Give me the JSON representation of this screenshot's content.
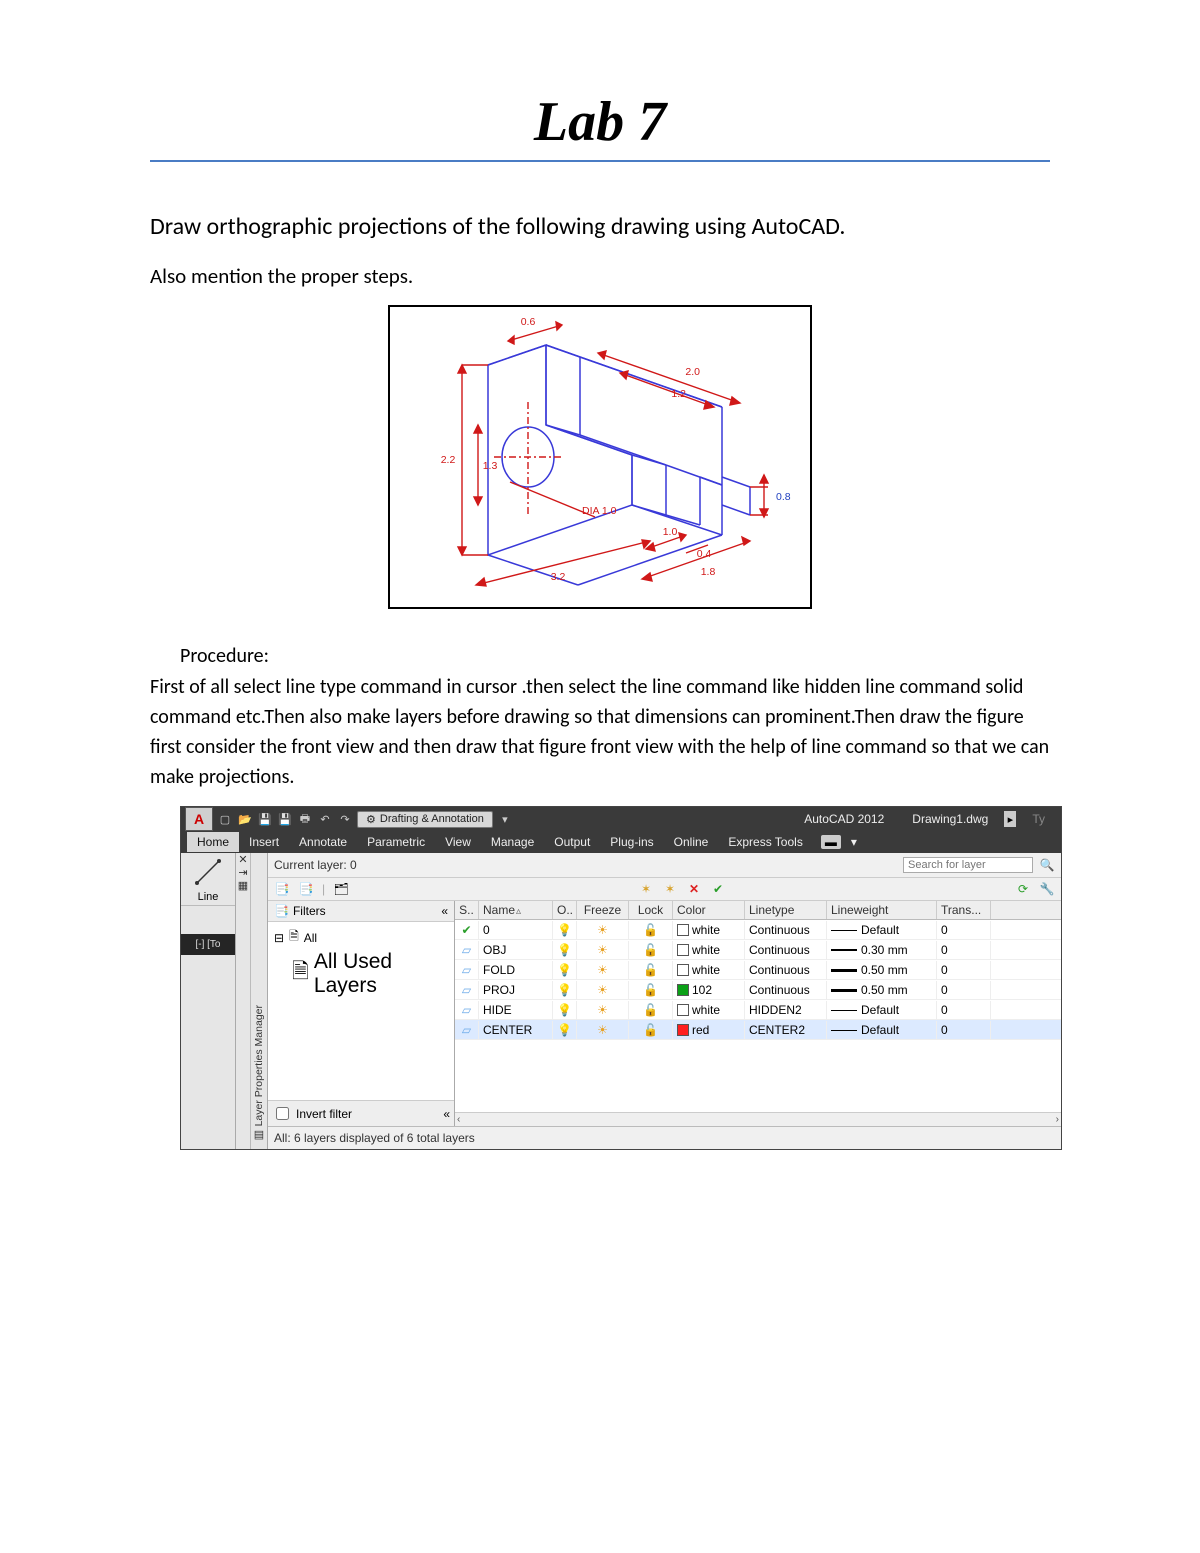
{
  "title": "Lab 7",
  "instruction": "Draw orthographic projections of the following drawing using AutoCAD.",
  "subinstruction": "Also mention the proper steps.",
  "iso_dims": {
    "d1": "0.6",
    "d2": "2.2",
    "d3": "1.3",
    "d4": "3.2",
    "d5": "2.0",
    "d6": "1.2",
    "d7": "0.8",
    "d8": "1.0",
    "d9": "0.4",
    "d10": "1.8",
    "dia": "DIA 1.0"
  },
  "procedure_heading": "Procedure:",
  "procedure_body": "First of all select line type command in cursor .then select the line command like hidden line command solid command etc.Then also make layers before drawing so that dimensions can prominent.Then draw the figure first consider the front view and then draw that figure front view with the help of line command so that we can make projections.",
  "autocad": {
    "app_name": "AutoCAD 2012",
    "doc_name": "Drawing1.dwg",
    "workspace": "Drafting & Annotation",
    "search_hint": "Ty",
    "tabs": [
      "Home",
      "Insert",
      "Annotate",
      "Parametric",
      "View",
      "Manage",
      "Output",
      "Plug-ins",
      "Online",
      "Express Tools"
    ],
    "line_tool_label": "Line",
    "left_dark_label": "[-] [To",
    "lpm": {
      "side_label": "Layer Properties Manager",
      "current_layer": "Current layer: 0",
      "search_placeholder": "Search for layer",
      "filters_label": "Filters",
      "collapse": "«",
      "tree_all": "All",
      "tree_used": "All Used Layers",
      "invert_label": "Invert filter",
      "status": "All: 6 layers displayed of 6 total layers",
      "headers": {
        "s": "S..",
        "name": "Name",
        "on": "O..",
        "freeze": "Freeze",
        "lock": "Lock",
        "color": "Color",
        "linetype": "Linetype",
        "lineweight": "Lineweight",
        "trans": "Trans..."
      },
      "rows": [
        {
          "status_icon": "check",
          "name": "0",
          "color_swatch": "#ffffff",
          "color": "white",
          "linetype": "Continuous",
          "lw_bar": 1,
          "lw": "Default",
          "trans": "0"
        },
        {
          "status_icon": "layer",
          "name": "OBJ",
          "color_swatch": "#ffffff",
          "color": "white",
          "linetype": "Continuous",
          "lw_bar": 2,
          "lw": "0.30 mm",
          "trans": "0"
        },
        {
          "status_icon": "layer",
          "name": "FOLD",
          "color_swatch": "#ffffff",
          "color": "white",
          "linetype": "Continuous",
          "lw_bar": 3.5,
          "lw": "0.50 mm",
          "trans": "0"
        },
        {
          "status_icon": "layer",
          "name": "PROJ",
          "color_swatch": "#0aa016",
          "color": "102",
          "linetype": "Continuous",
          "lw_bar": 3.5,
          "lw": "0.50 mm",
          "trans": "0"
        },
        {
          "status_icon": "layer",
          "name": "HIDE",
          "color_swatch": "#ffffff",
          "color": "white",
          "linetype": "HIDDEN2",
          "lw_bar": 1,
          "lw": "Default",
          "trans": "0"
        },
        {
          "status_icon": "layer",
          "name": "CENTER",
          "color_swatch": "#ff2020",
          "color": "red",
          "linetype": "CENTER2",
          "lw_bar": 1,
          "lw": "Default",
          "trans": "0",
          "selected": true
        }
      ]
    }
  }
}
